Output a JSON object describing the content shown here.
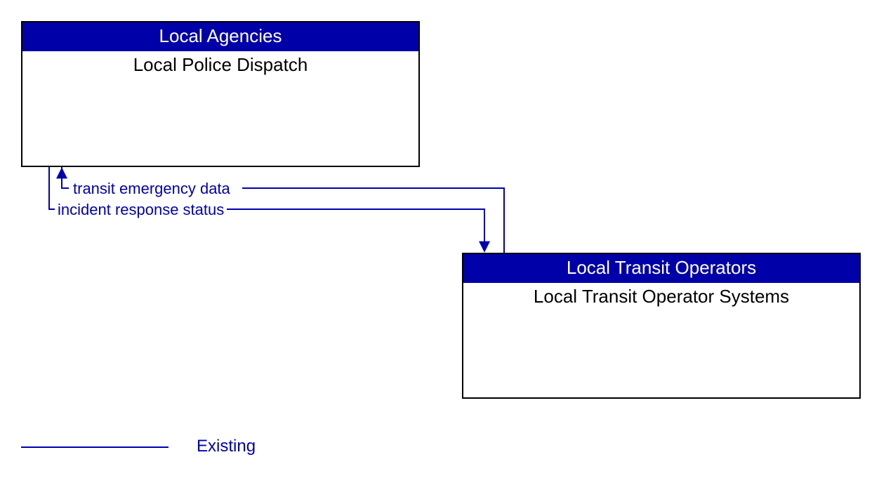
{
  "boxes": {
    "agencies": {
      "header": "Local Agencies",
      "body": "Local Police Dispatch"
    },
    "transit": {
      "header": "Local Transit Operators",
      "body": "Local Transit Operator Systems"
    }
  },
  "flows": {
    "to_agencies": "transit emergency data",
    "to_transit": "incident response status"
  },
  "legend": {
    "existing": "Existing"
  },
  "chart_data": {
    "type": "diagram",
    "nodes": [
      {
        "id": "local_police_dispatch",
        "group": "Local Agencies",
        "label": "Local Police Dispatch"
      },
      {
        "id": "local_transit_operator_systems",
        "group": "Local Transit Operators",
        "label": "Local Transit Operator Systems"
      }
    ],
    "edges": [
      {
        "from": "local_transit_operator_systems",
        "to": "local_police_dispatch",
        "label": "transit emergency data",
        "status": "Existing"
      },
      {
        "from": "local_police_dispatch",
        "to": "local_transit_operator_systems",
        "label": "incident response status",
        "status": "Existing"
      }
    ],
    "legend": [
      {
        "label": "Existing",
        "style": "solid-blue-line"
      }
    ]
  }
}
